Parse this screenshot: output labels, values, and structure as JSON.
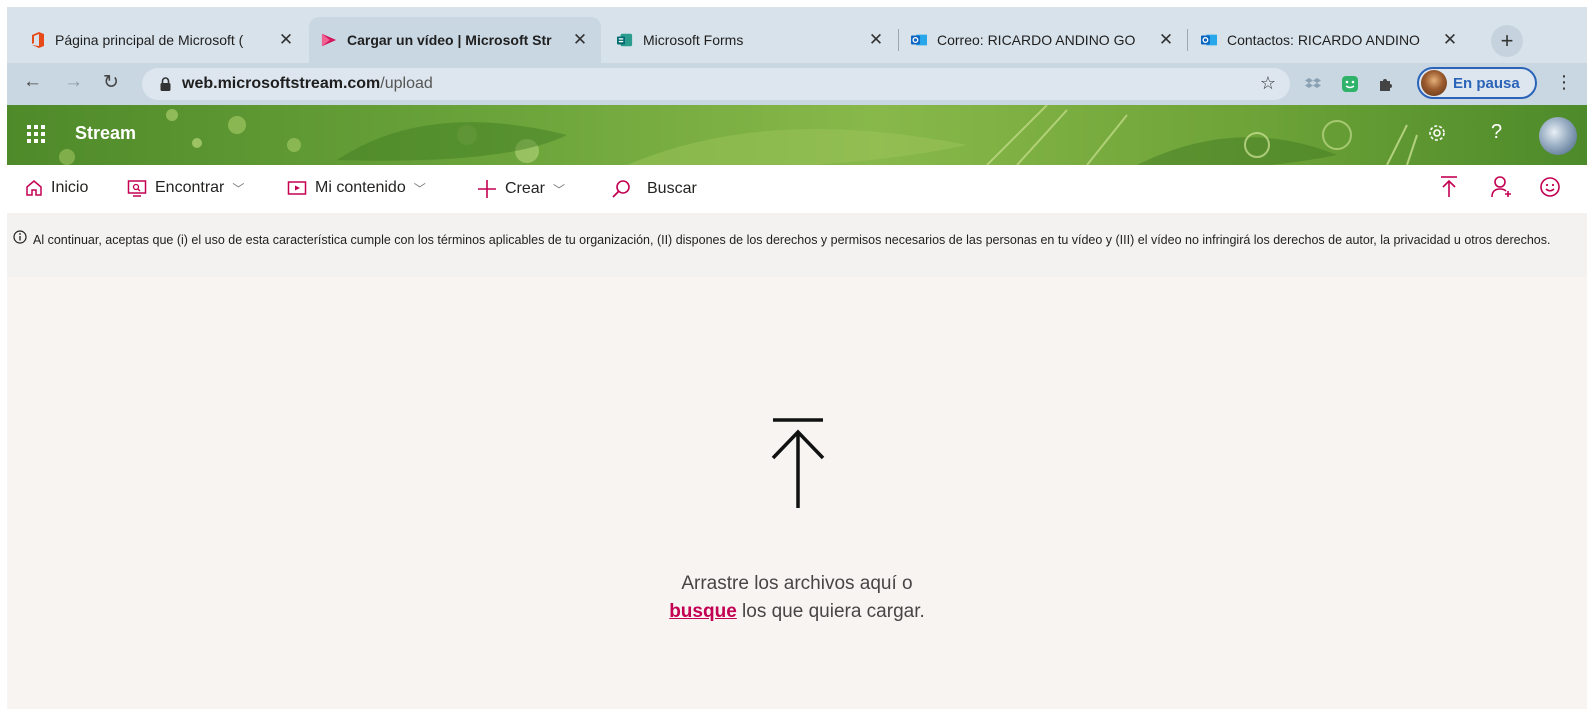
{
  "browser": {
    "tabs": [
      {
        "title": "Página principal de Microsoft (",
        "icon": "office-icon",
        "active": false
      },
      {
        "title": "Cargar un vídeo | Microsoft Str",
        "icon": "stream-icon",
        "active": true
      },
      {
        "title": "Microsoft Forms",
        "icon": "forms-icon",
        "active": false
      },
      {
        "title": "Correo: RICARDO ANDINO GO",
        "icon": "outlook-icon",
        "active": false
      },
      {
        "title": "Contactos: RICARDO ANDINO",
        "icon": "outlook-icon",
        "active": false
      }
    ],
    "tab_close_glyph": "✕",
    "new_tab_glyph": "+",
    "url_host": "web.microsoftstream.com",
    "url_path": "/upload",
    "profile_label": "En pausa"
  },
  "suite": {
    "app_name": "Stream"
  },
  "nav": {
    "items": [
      {
        "label": "Inicio",
        "icon": "home-icon",
        "dropdown": false
      },
      {
        "label": "Encontrar",
        "icon": "discover-icon",
        "dropdown": true
      },
      {
        "label": "Mi contenido",
        "icon": "video-icon",
        "dropdown": true
      },
      {
        "label": "Crear",
        "icon": "plus-icon",
        "dropdown": true
      },
      {
        "label": "Buscar",
        "icon": "search-icon",
        "dropdown": false
      }
    ]
  },
  "notice": {
    "text": "Al continuar, aceptas que (i) el uso de esta característica cumple con los términos aplicables de tu organización, (II) dispones de los derechos y permisos necesarios de las personas en tu vídeo y (III) el vídeo no infringirá los derechos de autor, la privacidad u otros derechos."
  },
  "upload": {
    "line1": "Arrastre los archivos aquí o",
    "link": "busque",
    "line2_rest": " los que quiera cargar."
  },
  "colors": {
    "accent": "#c30052",
    "suite_green": "#6aa33a",
    "tab_strip": "#d8e2ea",
    "toolbar": "#c9d7e3"
  }
}
